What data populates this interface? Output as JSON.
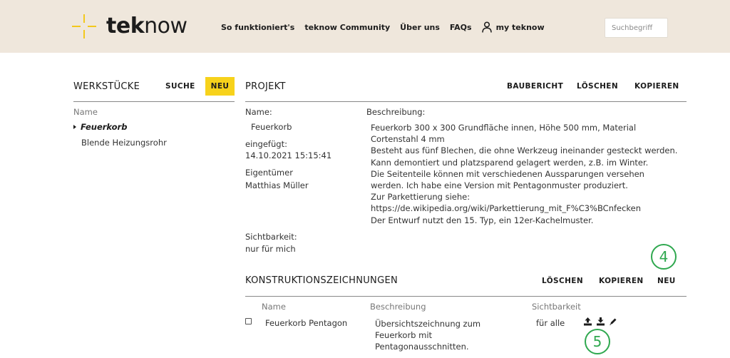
{
  "header": {
    "logo": {
      "bold": "tek",
      "light": "now"
    },
    "nav": [
      "So funktioniert's",
      "teknow Community",
      "Über uns",
      "FAQs"
    ],
    "user_link": "my teknow",
    "search_placeholder": "Suchbegriff"
  },
  "left": {
    "title": "WERKSTÜCKE",
    "search_label": "SUCHE",
    "new_label": "NEU",
    "column_name": "Name",
    "items": [
      "Feuerkorb",
      "Blende Heizungsrohr"
    ],
    "active_index": 0
  },
  "project": {
    "title": "PROJEKT",
    "actions": [
      "BAUBERICHT",
      "LÖSCHEN",
      "KOPIEREN"
    ],
    "name_label": "Name:",
    "name_value": "Feuerkorb",
    "inserted_label": "eingefügt:",
    "inserted_value": "14.10.2021 15:15:41",
    "owner_label": "Eigentümer",
    "owner_value": "Matthias Müller",
    "visibility_label": "Sichtbarkeit:",
    "visibility_value": "nur für mich",
    "description_label": "Beschreibung:",
    "description_lines": [
      "Feuerkorb 300 x 300 Grundfläche innen, Höhe 500 mm, Material",
      "Cortenstahl 4 mm",
      "Besteht aus fünf Blechen, die ohne Werkzeug ineinander gesteckt werden.",
      "Kann demontiert und platzsparend gelagert werden, z.B. im Winter.",
      "Die Seitenteile können mit verschiedenen Aussparungen versehen",
      "werden. Ich habe eine Version mit Pentagonmuster produziert.",
      "Zur Parkettierung siehe:",
      "https://de.wikipedia.org/wiki/Parkettierung_mit_F%C3%BCnfecken",
      "Der Entwurf nutzt den 15. Typ, ein 12er-Kachelmuster."
    ]
  },
  "drawings": {
    "title": "KONSTRUKTIONSZEICHNUNGEN",
    "actions": [
      "LÖSCHEN",
      "KOPIEREN",
      "NEU"
    ],
    "columns": [
      "Name",
      "Beschreibung",
      "Sichtbarkeit"
    ],
    "rows": [
      {
        "name": "Feuerkorb Pentagon",
        "description_lines": [
          "Übersichtszeichnung zum",
          "Feuerkorb mit",
          "Pentagonausschnitten."
        ],
        "visibility": "für alle",
        "icons": [
          "upload-icon",
          "download-icon",
          "edit-icon"
        ]
      }
    ]
  },
  "markers": [
    "4",
    "5"
  ],
  "colors": {
    "header_bg": "#efe7dc",
    "accent_yellow": "#f7d21b",
    "marker_green": "#2fa84f"
  }
}
